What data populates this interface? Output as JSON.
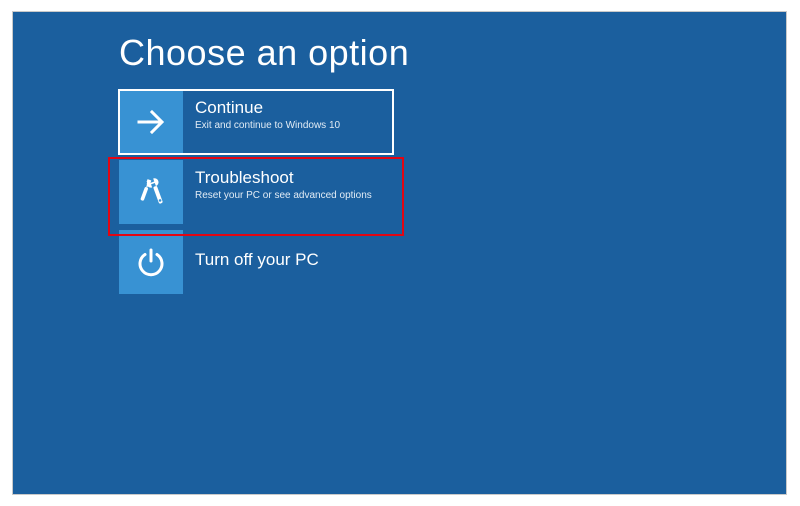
{
  "title": "Choose an option",
  "options": [
    {
      "icon": "arrow-right-icon",
      "title": "Continue",
      "desc": "Exit and continue to Windows 10",
      "selected": true
    },
    {
      "icon": "tools-icon",
      "title": "Troubleshoot",
      "desc": "Reset your PC or see advanced options",
      "selected": false,
      "highlighted": true
    },
    {
      "icon": "power-icon",
      "title": "Turn off your PC",
      "desc": "",
      "selected": false
    }
  ],
  "colors": {
    "background": "#1b5f9e",
    "tile": "#3892d3",
    "highlight": "#e30613"
  }
}
